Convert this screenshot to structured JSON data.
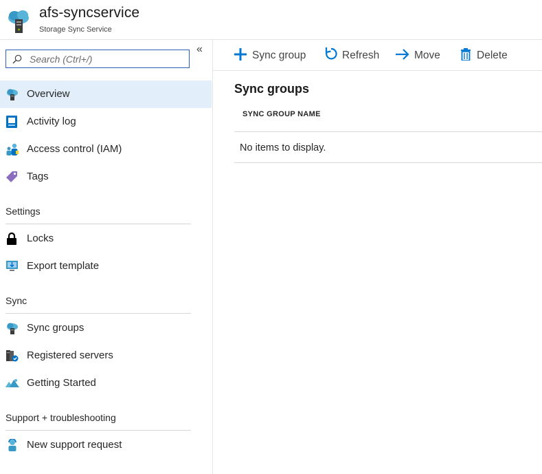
{
  "header": {
    "title": "afs-syncservice",
    "subtitle": "Storage Sync Service",
    "icon": "storage-sync-service-icon"
  },
  "search": {
    "placeholder": "Search (Ctrl+/)",
    "value": ""
  },
  "collapse_label": "«",
  "nav": {
    "top_items": [
      {
        "label": "Overview",
        "icon": "sync-service-icon",
        "selected": true
      },
      {
        "label": "Activity log",
        "icon": "activity-log-icon"
      },
      {
        "label": "Access control (IAM)",
        "icon": "iam-icon"
      },
      {
        "label": "Tags",
        "icon": "tag-icon"
      }
    ],
    "sections": [
      {
        "heading": "Settings",
        "items": [
          {
            "label": "Locks",
            "icon": "lock-icon"
          },
          {
            "label": "Export template",
            "icon": "export-template-icon"
          }
        ]
      },
      {
        "heading": "Sync",
        "items": [
          {
            "label": "Sync groups",
            "icon": "sync-groups-icon"
          },
          {
            "label": "Registered servers",
            "icon": "registered-servers-icon"
          },
          {
            "label": "Getting Started",
            "icon": "getting-started-icon"
          }
        ]
      },
      {
        "heading": "Support + troubleshooting",
        "items": [
          {
            "label": "New support request",
            "icon": "support-request-icon"
          }
        ]
      }
    ]
  },
  "toolbar": {
    "sync_group_label": "Sync group",
    "refresh_label": "Refresh",
    "move_label": "Move",
    "delete_label": "Delete"
  },
  "main": {
    "title": "Sync groups",
    "column_header": "SYNC GROUP NAME",
    "empty_message": "No items to display."
  },
  "colors": {
    "accent": "#0078d4",
    "selected_bg": "#e2effb",
    "search_border": "#2a5eb8"
  }
}
